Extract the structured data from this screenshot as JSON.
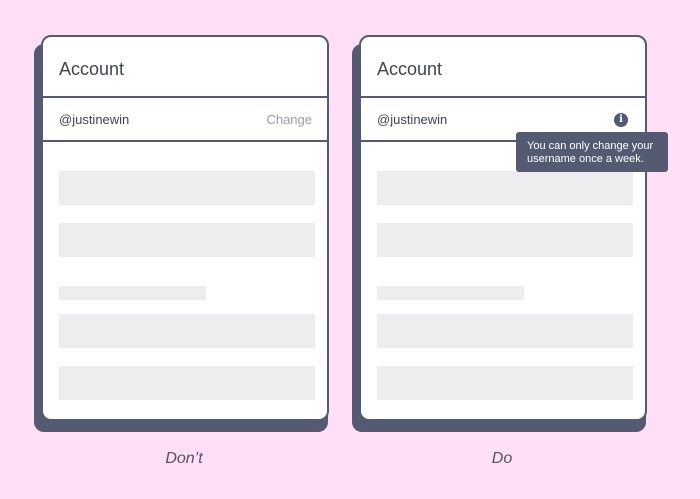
{
  "panels": {
    "dont": {
      "title": "Account",
      "username": "@justinewin",
      "change_label": "Change",
      "caption": "Don’t"
    },
    "do": {
      "title": "Account",
      "username": "@justinewin",
      "info_icon": "info-icon",
      "tooltip_line1": "You can only change your",
      "tooltip_line2": "username once a week.",
      "caption": "Do"
    }
  },
  "colors": {
    "background": "#FFDFF5",
    "card_border": "#535A72",
    "placeholder": "#EDEDEF",
    "muted_text": "#9A9DA6"
  }
}
